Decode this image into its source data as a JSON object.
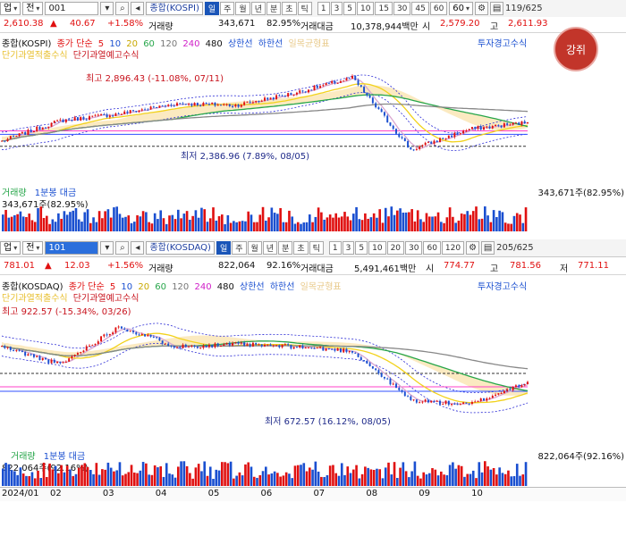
{
  "kospi": {
    "toolbar": {
      "type_label": "업",
      "type2_label": "전",
      "code": "001",
      "index_name": "종합(KOSPI)",
      "periods": [
        "일",
        "주",
        "월",
        "년",
        "분",
        "초",
        "틱"
      ],
      "numbers": [
        "1",
        "3",
        "5",
        "10",
        "15",
        "30",
        "45",
        "60"
      ],
      "num_select": "60",
      "counter": "119/625"
    },
    "price": {
      "last": "2,610.38",
      "arrow": "▲",
      "change": "40.67",
      "pct": "+1.58%",
      "vol_label": "거래량",
      "volume": "343,671",
      "vol_pct": "82.95%",
      "amt_label": "거래대금",
      "amount": "10,378,944백만",
      "open_label": "시",
      "open": "2,579.20",
      "high_label": "고",
      "high": "2,611.93"
    },
    "legend": {
      "title": "종합(KOSPI)",
      "ma_label": "종가 단순",
      "ma": [
        "5",
        "10",
        "20",
        "60",
        "120",
        "240",
        "480"
      ],
      "upper": "상한선",
      "lower": "하한선",
      "ichimoku": "일목균형표",
      "invest_warning": "투자경고수식",
      "line2a": "단기과열적출수식",
      "line2b": "단기과열예고수식"
    },
    "annot": {
      "max": "최고 2,896.43 (-11.08%, 07/11)",
      "min": "최저 2,386.96 (7.89%, 08/05)"
    },
    "volume": {
      "label": "거래량",
      "sub": "1분봉 대금",
      "left_value": "343,671주(82.95%)",
      "right_value": "343,671주(82.95%)"
    }
  },
  "kosdaq": {
    "toolbar": {
      "type_label": "업",
      "type2_label": "전",
      "code": "101",
      "index_name": "종합(KOSDAQ)",
      "periods": [
        "일",
        "주",
        "월",
        "년",
        "분",
        "초",
        "틱"
      ],
      "numbers": [
        "1",
        "3",
        "5",
        "10",
        "20",
        "30",
        "60",
        "120"
      ],
      "counter": "205/625"
    },
    "price": {
      "last": "781.01",
      "arrow": "▲",
      "change": "12.03",
      "pct": "+1.56%",
      "vol_label": "거래량",
      "volume": "822,064",
      "vol_pct": "92.16%",
      "amt_label": "거래대금",
      "amount": "5,491,461백만",
      "open_label": "시",
      "open": "774.77",
      "high_label": "고",
      "high": "781.56",
      "low_label": "저",
      "low": "771.11"
    },
    "legend": {
      "title": "종합(KOSDAQ)",
      "ma_label": "종가 단순",
      "ma": [
        "5",
        "10",
        "20",
        "60",
        "120",
        "240",
        "480"
      ],
      "upper": "상한선",
      "lower": "하한선",
      "ichimoku": "일목균형표",
      "invest_warning": "투자경고수식",
      "line2a": "단기과열적출수식",
      "line2b": "단기과열예고수식"
    },
    "annot": {
      "max": "최고 922.57 (-15.34%, 03/26)",
      "min": "최저 672.57 (16.12%, 08/05)"
    },
    "volume": {
      "label": "거래량",
      "sub": "1분봉 대금",
      "left_value": "822,064주(92.16%)",
      "right_value": "822,064주(92.16%)"
    }
  },
  "stamp_text": "강쥐",
  "colors": {
    "up": "#e01010",
    "down": "#1a4fd0",
    "ma5": "#d9a6d0",
    "ma20": "#f2d21c",
    "ma60": "#27a64a",
    "ma120": "#888888",
    "ma240": "#e056c8",
    "cloud": "#f8d98e",
    "band": "#2b2bd6"
  },
  "chart_data": [
    {
      "type": "line",
      "title": "종합(KOSPI)",
      "x": [
        "2024/01",
        "02",
        "03",
        "04",
        "05",
        "06",
        "07",
        "08",
        "09",
        "10"
      ],
      "series": [
        {
          "name": "종합(KOSPI)",
          "values": [
            2500,
            2620,
            2660,
            2720,
            2710,
            2780,
            2870,
            2450,
            2570,
            2610
          ]
        }
      ],
      "max_point": {
        "value": 2896.43,
        "date": "07/11"
      },
      "min_point": {
        "value": 2386.96,
        "date": "08/05"
      }
    },
    {
      "type": "line",
      "title": "종합(KOSDAQ)",
      "x": [
        "2024/01",
        "02",
        "03",
        "04",
        "05",
        "06",
        "07",
        "08",
        "09",
        "10"
      ],
      "series": [
        {
          "name": "종합(KOSDAQ)",
          "values": [
            860,
            820,
            905,
            860,
            865,
            860,
            850,
            740,
            730,
            781
          ]
        }
      ],
      "max_point": {
        "value": 922.57,
        "date": "03/26"
      },
      "min_point": {
        "value": 672.57,
        "date": "08/05"
      }
    }
  ],
  "xaxis_labels": [
    "2024/01",
    "02",
    "03",
    "04",
    "05",
    "06",
    "07",
    "08",
    "09",
    "10"
  ]
}
